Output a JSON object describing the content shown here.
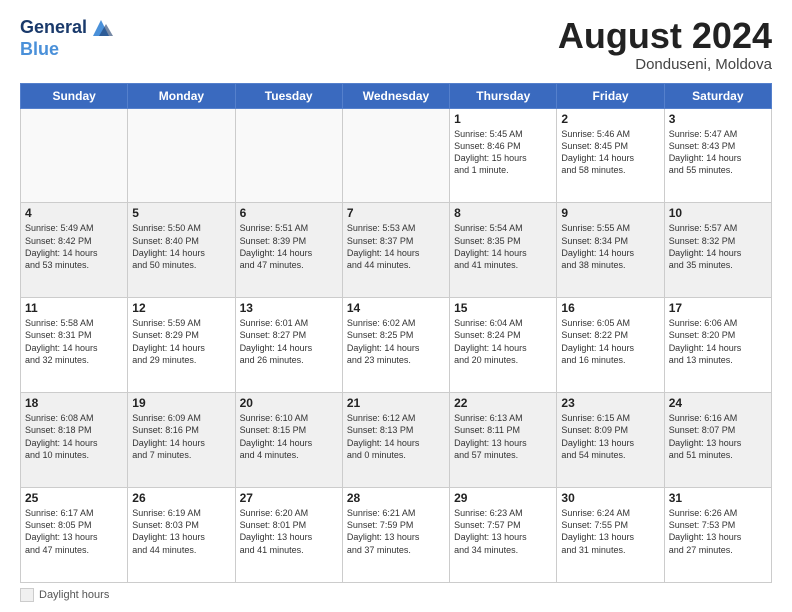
{
  "header": {
    "logo_line1": "General",
    "logo_line2": "Blue",
    "month_title": "August 2024",
    "location": "Donduseni, Moldova"
  },
  "footer": {
    "daylight_label": "Daylight hours"
  },
  "days_of_week": [
    "Sunday",
    "Monday",
    "Tuesday",
    "Wednesday",
    "Thursday",
    "Friday",
    "Saturday"
  ],
  "weeks": [
    [
      {
        "num": "",
        "info": "",
        "empty": true
      },
      {
        "num": "",
        "info": "",
        "empty": true
      },
      {
        "num": "",
        "info": "",
        "empty": true
      },
      {
        "num": "",
        "info": "",
        "empty": true
      },
      {
        "num": "1",
        "info": "Sunrise: 5:45 AM\nSunset: 8:46 PM\nDaylight: 15 hours\nand 1 minute."
      },
      {
        "num": "2",
        "info": "Sunrise: 5:46 AM\nSunset: 8:45 PM\nDaylight: 14 hours\nand 58 minutes."
      },
      {
        "num": "3",
        "info": "Sunrise: 5:47 AM\nSunset: 8:43 PM\nDaylight: 14 hours\nand 55 minutes."
      }
    ],
    [
      {
        "num": "4",
        "info": "Sunrise: 5:49 AM\nSunset: 8:42 PM\nDaylight: 14 hours\nand 53 minutes.",
        "shade": true
      },
      {
        "num": "5",
        "info": "Sunrise: 5:50 AM\nSunset: 8:40 PM\nDaylight: 14 hours\nand 50 minutes.",
        "shade": true
      },
      {
        "num": "6",
        "info": "Sunrise: 5:51 AM\nSunset: 8:39 PM\nDaylight: 14 hours\nand 47 minutes.",
        "shade": true
      },
      {
        "num": "7",
        "info": "Sunrise: 5:53 AM\nSunset: 8:37 PM\nDaylight: 14 hours\nand 44 minutes.",
        "shade": true
      },
      {
        "num": "8",
        "info": "Sunrise: 5:54 AM\nSunset: 8:35 PM\nDaylight: 14 hours\nand 41 minutes.",
        "shade": true
      },
      {
        "num": "9",
        "info": "Sunrise: 5:55 AM\nSunset: 8:34 PM\nDaylight: 14 hours\nand 38 minutes.",
        "shade": true
      },
      {
        "num": "10",
        "info": "Sunrise: 5:57 AM\nSunset: 8:32 PM\nDaylight: 14 hours\nand 35 minutes.",
        "shade": true
      }
    ],
    [
      {
        "num": "11",
        "info": "Sunrise: 5:58 AM\nSunset: 8:31 PM\nDaylight: 14 hours\nand 32 minutes."
      },
      {
        "num": "12",
        "info": "Sunrise: 5:59 AM\nSunset: 8:29 PM\nDaylight: 14 hours\nand 29 minutes."
      },
      {
        "num": "13",
        "info": "Sunrise: 6:01 AM\nSunset: 8:27 PM\nDaylight: 14 hours\nand 26 minutes."
      },
      {
        "num": "14",
        "info": "Sunrise: 6:02 AM\nSunset: 8:25 PM\nDaylight: 14 hours\nand 23 minutes."
      },
      {
        "num": "15",
        "info": "Sunrise: 6:04 AM\nSunset: 8:24 PM\nDaylight: 14 hours\nand 20 minutes."
      },
      {
        "num": "16",
        "info": "Sunrise: 6:05 AM\nSunset: 8:22 PM\nDaylight: 14 hours\nand 16 minutes."
      },
      {
        "num": "17",
        "info": "Sunrise: 6:06 AM\nSunset: 8:20 PM\nDaylight: 14 hours\nand 13 minutes."
      }
    ],
    [
      {
        "num": "18",
        "info": "Sunrise: 6:08 AM\nSunset: 8:18 PM\nDaylight: 14 hours\nand 10 minutes.",
        "shade": true
      },
      {
        "num": "19",
        "info": "Sunrise: 6:09 AM\nSunset: 8:16 PM\nDaylight: 14 hours\nand 7 minutes.",
        "shade": true
      },
      {
        "num": "20",
        "info": "Sunrise: 6:10 AM\nSunset: 8:15 PM\nDaylight: 14 hours\nand 4 minutes.",
        "shade": true
      },
      {
        "num": "21",
        "info": "Sunrise: 6:12 AM\nSunset: 8:13 PM\nDaylight: 14 hours\nand 0 minutes.",
        "shade": true
      },
      {
        "num": "22",
        "info": "Sunrise: 6:13 AM\nSunset: 8:11 PM\nDaylight: 13 hours\nand 57 minutes.",
        "shade": true
      },
      {
        "num": "23",
        "info": "Sunrise: 6:15 AM\nSunset: 8:09 PM\nDaylight: 13 hours\nand 54 minutes.",
        "shade": true
      },
      {
        "num": "24",
        "info": "Sunrise: 6:16 AM\nSunset: 8:07 PM\nDaylight: 13 hours\nand 51 minutes.",
        "shade": true
      }
    ],
    [
      {
        "num": "25",
        "info": "Sunrise: 6:17 AM\nSunset: 8:05 PM\nDaylight: 13 hours\nand 47 minutes."
      },
      {
        "num": "26",
        "info": "Sunrise: 6:19 AM\nSunset: 8:03 PM\nDaylight: 13 hours\nand 44 minutes."
      },
      {
        "num": "27",
        "info": "Sunrise: 6:20 AM\nSunset: 8:01 PM\nDaylight: 13 hours\nand 41 minutes."
      },
      {
        "num": "28",
        "info": "Sunrise: 6:21 AM\nSunset: 7:59 PM\nDaylight: 13 hours\nand 37 minutes."
      },
      {
        "num": "29",
        "info": "Sunrise: 6:23 AM\nSunset: 7:57 PM\nDaylight: 13 hours\nand 34 minutes."
      },
      {
        "num": "30",
        "info": "Sunrise: 6:24 AM\nSunset: 7:55 PM\nDaylight: 13 hours\nand 31 minutes."
      },
      {
        "num": "31",
        "info": "Sunrise: 6:26 AM\nSunset: 7:53 PM\nDaylight: 13 hours\nand 27 minutes."
      }
    ]
  ]
}
